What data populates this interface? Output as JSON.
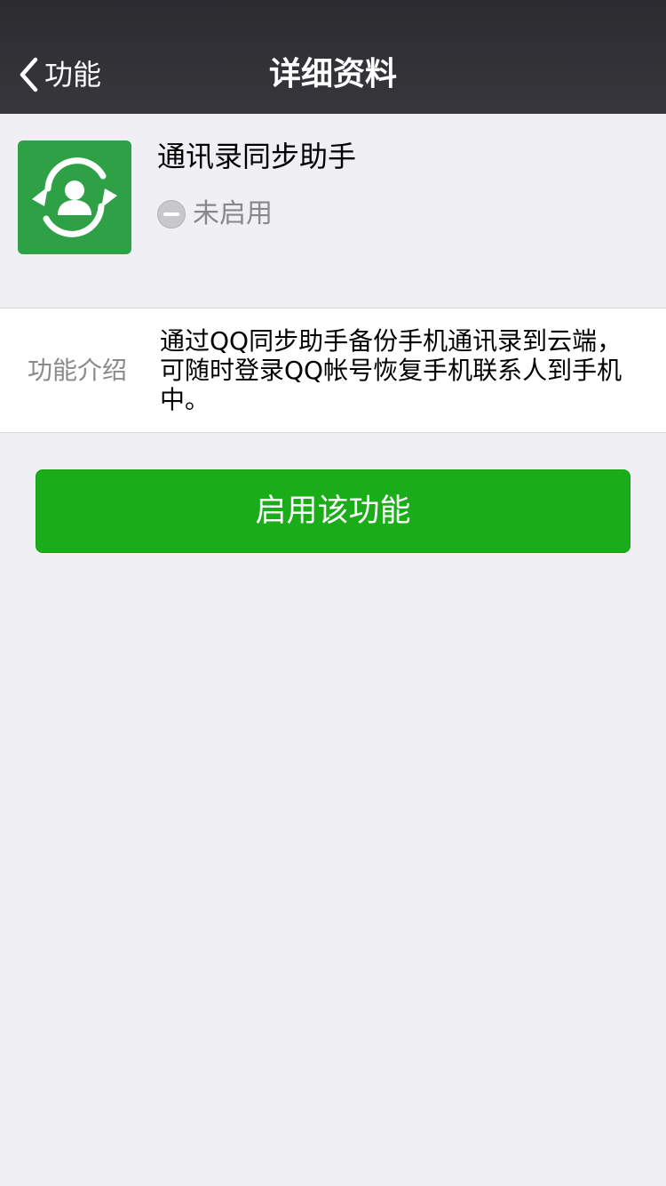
{
  "navbar": {
    "back_label": "功能",
    "title": "详细资料"
  },
  "plugin": {
    "icon": "contact-sync-icon",
    "name": "通讯录同步助手",
    "status_icon": "disabled-minus-icon",
    "status": "未启用"
  },
  "intro": {
    "label": "功能介绍",
    "text": "通过QQ同步助手备份手机通讯录到云端，可随时登录QQ帐号恢复手机联系人到手机中。"
  },
  "actions": {
    "enable_label": "启用该功能"
  },
  "colors": {
    "navbar": "#2c2b30",
    "icon_bg": "#2ea146",
    "button": "#1aad19",
    "page_bg": "#efeff4"
  }
}
